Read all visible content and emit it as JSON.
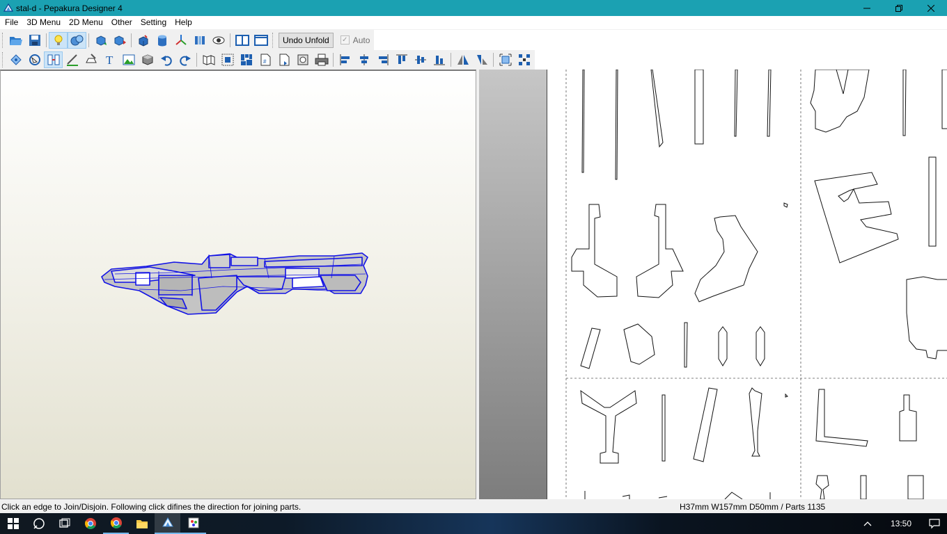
{
  "window": {
    "title": "stal-d - Pepakura Designer 4",
    "controls": [
      "minimize-icon",
      "maximize-icon",
      "close-icon"
    ]
  },
  "menu": {
    "items": [
      "File",
      "3D Menu",
      "2D Menu",
      "Other",
      "Setting",
      "Help"
    ]
  },
  "toolbar1": {
    "buttons": [
      "open-icon",
      "save-icon",
      "light-icon",
      "texture-icon",
      "rotate-part-icon",
      "move-part-icon",
      "cube-icon",
      "cylinder-icon",
      "axis-icon",
      "split-view-icon",
      "eye-icon",
      "layout-two-pane-icon",
      "layout-single-pane-icon"
    ],
    "undo_unfold_label": "Undo Unfold",
    "auto_label": "Auto",
    "auto_checked": true
  },
  "toolbar2": {
    "buttons": [
      "select-rotate-icon",
      "rotate-icon",
      "join-edge-icon",
      "fold-line-icon",
      "edit-flap-icon",
      "text-icon",
      "image-icon",
      "box-icon",
      "undo-icon",
      "redo-icon",
      "unfold-icon",
      "arrange-icon",
      "tile-icon",
      "page-number-icon",
      "page-setup-icon",
      "print-preview-icon",
      "print-icon",
      "align-left-icon",
      "align-center-icon",
      "align-right-icon",
      "align-top-icon",
      "align-middle-icon",
      "align-bottom-icon",
      "flip-horizontal-icon",
      "flip-vertical-icon",
      "fit-icon",
      "distribute-icon"
    ]
  },
  "status": {
    "hint": "Click an edge to Join/Disjoin. Following click difines the direction for joining parts.",
    "dimensions": "H37mm W157mm D50mm / Parts 1135"
  },
  "taskbar": {
    "apps": [
      "start-icon",
      "search-icon",
      "task-view-icon",
      "chrome-icon",
      "chrome-icon-2",
      "file-explorer-icon",
      "pepakura-icon",
      "paint-icon"
    ],
    "clock": "13:50",
    "tray": [
      "show-hidden-icons-icon",
      "notification-icon"
    ]
  },
  "colors": {
    "titlebar": "#1ba1b2",
    "model_edge": "#1212e6",
    "model_fill": "#c4c4c4"
  }
}
